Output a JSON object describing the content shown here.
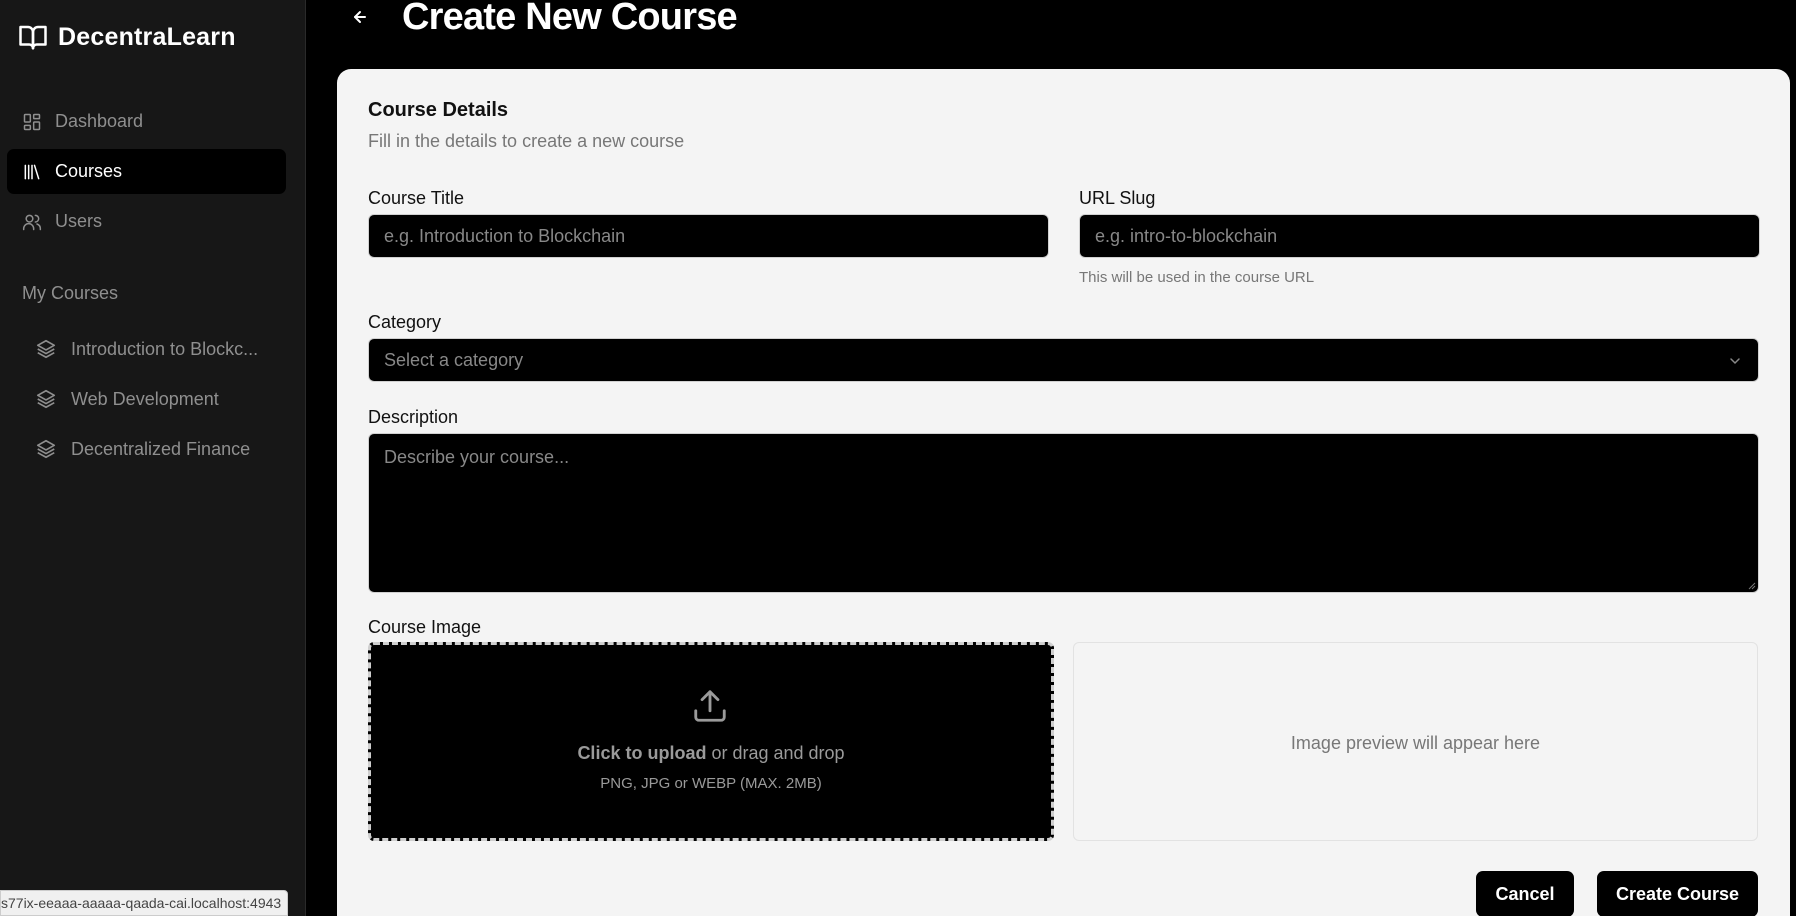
{
  "app": {
    "brand": "DecentraLearn"
  },
  "sidebar": {
    "items": [
      {
        "label": "Dashboard",
        "icon": "dashboard-icon",
        "active": false
      },
      {
        "label": "Courses",
        "icon": "library-icon",
        "active": true
      },
      {
        "label": "Users",
        "icon": "users-icon",
        "active": false
      }
    ],
    "section_title": "My Courses",
    "my_courses": [
      {
        "label": "Introduction to Blockc...",
        "icon": "layers-icon"
      },
      {
        "label": "Web Development",
        "icon": "layers-icon"
      },
      {
        "label": "Decentralized Finance",
        "icon": "layers-icon"
      }
    ]
  },
  "status_bar": {
    "url": "s77ix-eeaaa-aaaaa-qaada-cai.localhost:4943"
  },
  "header": {
    "title": "Create New Course",
    "back_icon": "arrow-left-icon"
  },
  "form": {
    "heading": "Course Details",
    "subheading": "Fill in the details to create a new course",
    "title_label": "Course Title",
    "title_placeholder": "e.g. Introduction to Blockchain",
    "title_value": "",
    "slug_label": "URL Slug",
    "slug_placeholder": "e.g. intro-to-blockchain",
    "slug_value": "",
    "slug_hint": "This will be used in the course URL",
    "category_label": "Category",
    "category_value": "Select a category",
    "description_label": "Description",
    "description_placeholder": "Describe your course...",
    "description_value": "",
    "image_label": "Course Image",
    "upload_strong": "Click to upload",
    "upload_rest": " or drag and drop",
    "upload_hint": "PNG, JPG or WEBP (MAX. 2MB)",
    "preview_text": "Image preview will appear here",
    "cancel_label": "Cancel",
    "submit_label": "Create Course"
  },
  "colors": {
    "background": "#000000",
    "sidebar": "#171717",
    "card": "#f4f4f4",
    "muted": "#8f8f8f"
  }
}
